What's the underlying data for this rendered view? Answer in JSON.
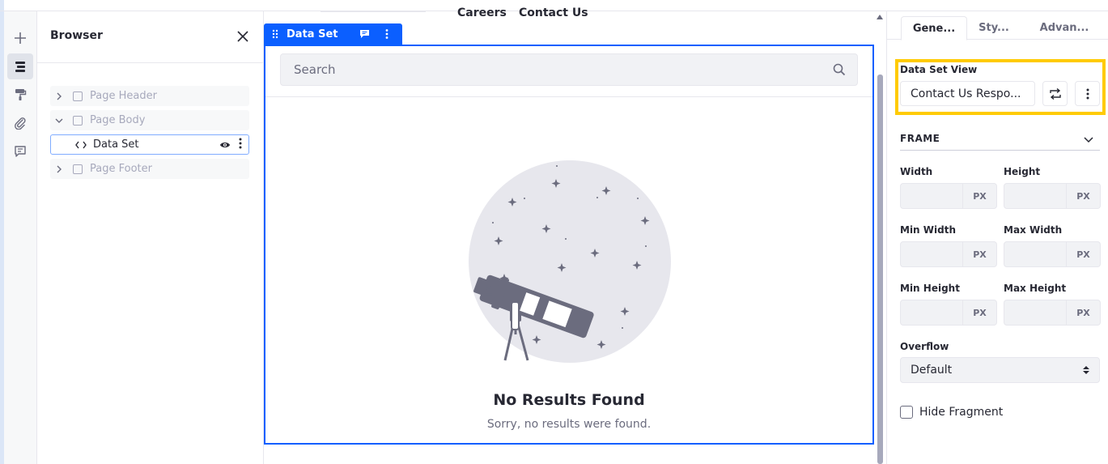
{
  "rail": {
    "items": [
      {
        "icon": "plus-icon"
      },
      {
        "icon": "browser-tree-icon",
        "active": true
      },
      {
        "icon": "paint-roller-icon"
      },
      {
        "icon": "paperclip-icon"
      },
      {
        "icon": "comment-icon"
      }
    ]
  },
  "browser": {
    "title": "Browser",
    "tree": [
      {
        "label": "Page Header",
        "expanded": false
      },
      {
        "label": "Page Body",
        "expanded": true
      },
      {
        "label": "Data Set",
        "selected": true
      },
      {
        "label": "Page Footer",
        "expanded": false
      }
    ]
  },
  "canvas": {
    "nav": [
      "Careers",
      "Contact Us"
    ],
    "fragment_label": "Data Set",
    "search_placeholder": "Search",
    "empty_title": "No Results Found",
    "empty_subtitle": "Sorry, no results were found."
  },
  "panel": {
    "tabs": [
      "Gene...",
      "Sty...",
      "Advan..."
    ],
    "data_set_view_label": "Data Set View",
    "data_set_view_value": "Contact Us Respo...",
    "frame_title": "FRAME",
    "fields": {
      "width": "Width",
      "height": "Height",
      "min_width": "Min Width",
      "max_width": "Max Width",
      "min_height": "Min Height",
      "max_height": "Max Height"
    },
    "unit": "PX",
    "overflow_label": "Overflow",
    "overflow_value": "Default",
    "hide_fragment_label": "Hide Fragment"
  },
  "colors": {
    "primary": "#0b5fff",
    "highlight": "#ffcb05",
    "muted_text": "#a7a9bc"
  }
}
